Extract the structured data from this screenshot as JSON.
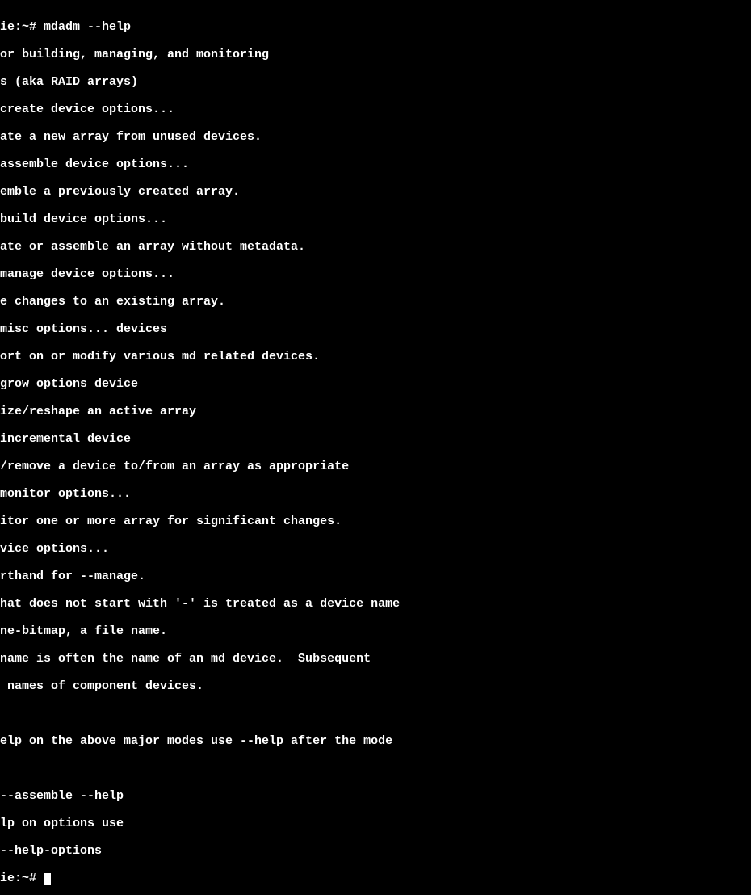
{
  "terminal": {
    "lines": [
      "ie:~# mdadm --help",
      "or building, managing, and monitoring",
      "s (aka RAID arrays)",
      "create device options...",
      "ate a new array from unused devices.",
      "assemble device options...",
      "emble a previously created array.",
      "build device options...",
      "ate or assemble an array without metadata.",
      "manage device options...",
      "e changes to an existing array.",
      "misc options... devices",
      "ort on or modify various md related devices.",
      "grow options device",
      "ize/reshape an active array",
      "incremental device",
      "/remove a device to/from an array as appropriate",
      "monitor options...",
      "itor one or more array for significant changes.",
      "vice options...",
      "rthand for --manage.",
      "hat does not start with '-' is treated as a device name",
      "ne-bitmap, a file name.",
      "name is often the name of an md device.  Subsequent",
      " names of component devices.",
      "",
      "elp on the above major modes use --help after the mode",
      "",
      "--assemble --help",
      "lp on options use",
      "--help-options",
      "ie:~# "
    ],
    "prompt": "ie:~# "
  }
}
